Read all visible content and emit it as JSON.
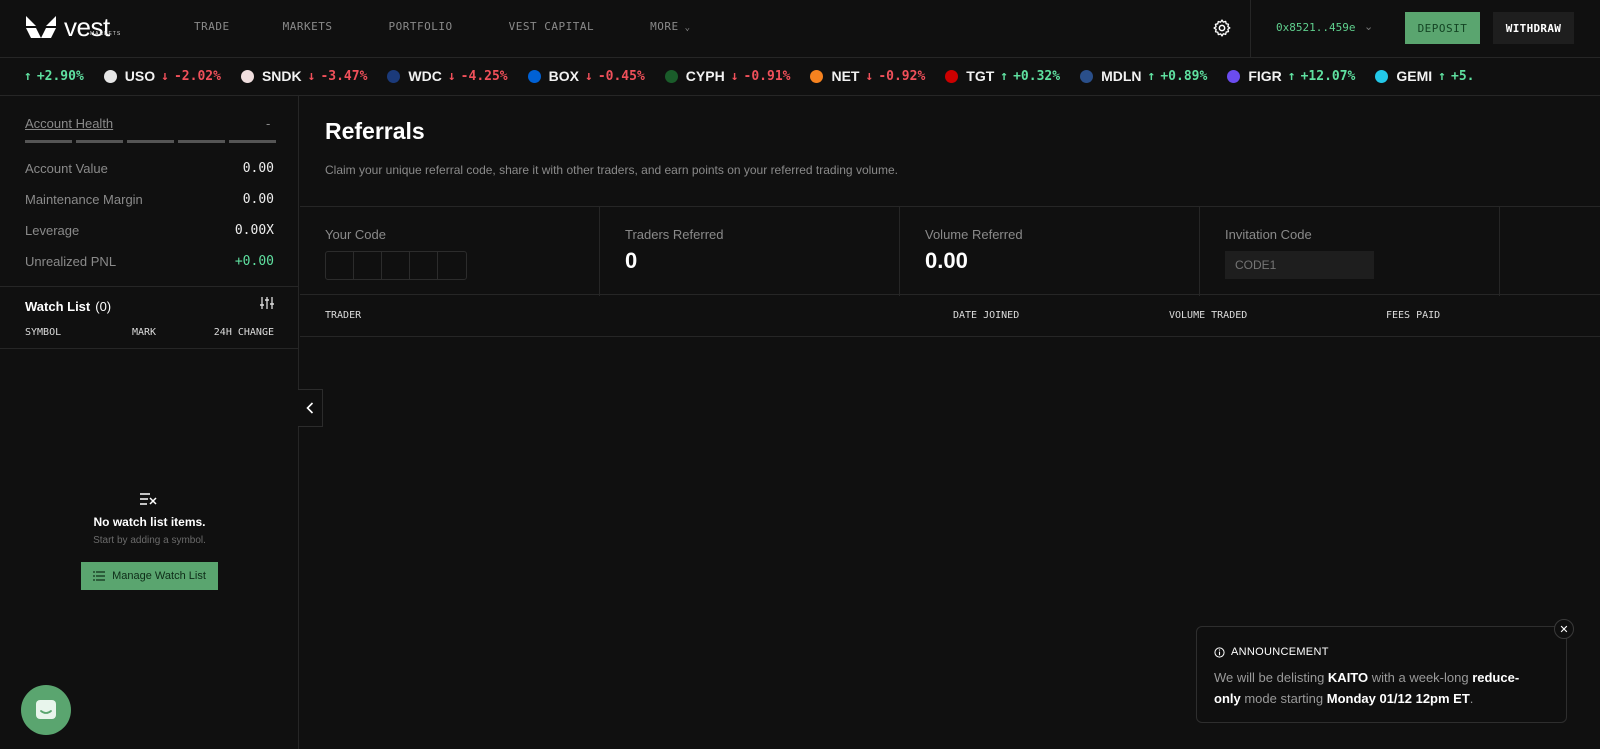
{
  "brand": {
    "name": "vest",
    "sub": "MARKETS"
  },
  "nav": {
    "links": [
      "TRADE",
      "MARKETS",
      "PORTFOLIO",
      "VEST CAPITAL",
      "MORE"
    ],
    "wallet": "0x8521..459e",
    "deposit": "DEPOSIT",
    "withdraw": "WITHDRAW"
  },
  "ticker": [
    {
      "symbol": "",
      "change": "+2.90%",
      "dir": "up",
      "color": ""
    },
    {
      "symbol": "USO",
      "change": "-2.02%",
      "dir": "down",
      "color": "#e6e6e6"
    },
    {
      "symbol": "SNDK",
      "change": "-3.47%",
      "dir": "down",
      "color": "#f0dede"
    },
    {
      "symbol": "WDC",
      "change": "-4.25%",
      "dir": "down",
      "color": "#1b3a7a"
    },
    {
      "symbol": "BOX",
      "change": "-0.45%",
      "dir": "down",
      "color": "#0061d5"
    },
    {
      "symbol": "CYPH",
      "change": "-0.91%",
      "dir": "down",
      "color": "#1a5c2a"
    },
    {
      "symbol": "NET",
      "change": "-0.92%",
      "dir": "down",
      "color": "#f6821f"
    },
    {
      "symbol": "TGT",
      "change": "+0.32%",
      "dir": "up",
      "color": "#cc0000"
    },
    {
      "symbol": "MDLN",
      "change": "+0.89%",
      "dir": "up",
      "color": "#2a4f8a"
    },
    {
      "symbol": "FIGR",
      "change": "+12.07%",
      "dir": "up",
      "color": "#6b4cf0"
    },
    {
      "symbol": "GEMI",
      "change": "+5.",
      "dir": "up",
      "color": "#23c8e8"
    }
  ],
  "sidebar": {
    "account_health": "Account Health",
    "account_health_value": "-",
    "metrics": [
      {
        "label": "Account Value",
        "value": "0.00",
        "color": "default"
      },
      {
        "label": "Maintenance Margin",
        "value": "0.00",
        "color": "default"
      },
      {
        "label": "Leverage",
        "value": "0.00X",
        "color": "default"
      },
      {
        "label": "Unrealized PNL",
        "value": "+0.00",
        "color": "green"
      }
    ],
    "watchlist": {
      "title": "Watch List",
      "count": "(0)",
      "columns": [
        "SYMBOL",
        "MARK",
        "24H CHANGE"
      ],
      "empty_title": "No watch list items.",
      "empty_sub": "Start by adding a symbol.",
      "manage_button": "Manage Watch List"
    }
  },
  "main": {
    "title": "Referrals",
    "description": "Claim your unique referral code, share it with other traders, and earn points on your referred trading volume.",
    "stats": {
      "your_code": {
        "label": "Your Code"
      },
      "traders_referred": {
        "label": "Traders Referred",
        "value": "0"
      },
      "volume_referred": {
        "label": "Volume Referred",
        "value": "0.00"
      },
      "invitation_code": {
        "label": "Invitation Code",
        "placeholder": "CODE1"
      }
    },
    "table_columns": [
      "TRADER",
      "DATE JOINED",
      "VOLUME TRADED",
      "FEES PAID"
    ]
  },
  "announcement": {
    "heading": "ANNOUNCEMENT",
    "p1": "We will be delisting ",
    "b1": "KAITO",
    "p2": " with a week-long ",
    "b2": "reduce-only",
    "p3": " mode starting ",
    "b3": "Monday 01/12 12pm ET",
    "p4": "."
  },
  "colors": {
    "accent": "#5aa56f",
    "up": "#5fe0a0",
    "down": "#f0505a",
    "bg": "#101010"
  }
}
